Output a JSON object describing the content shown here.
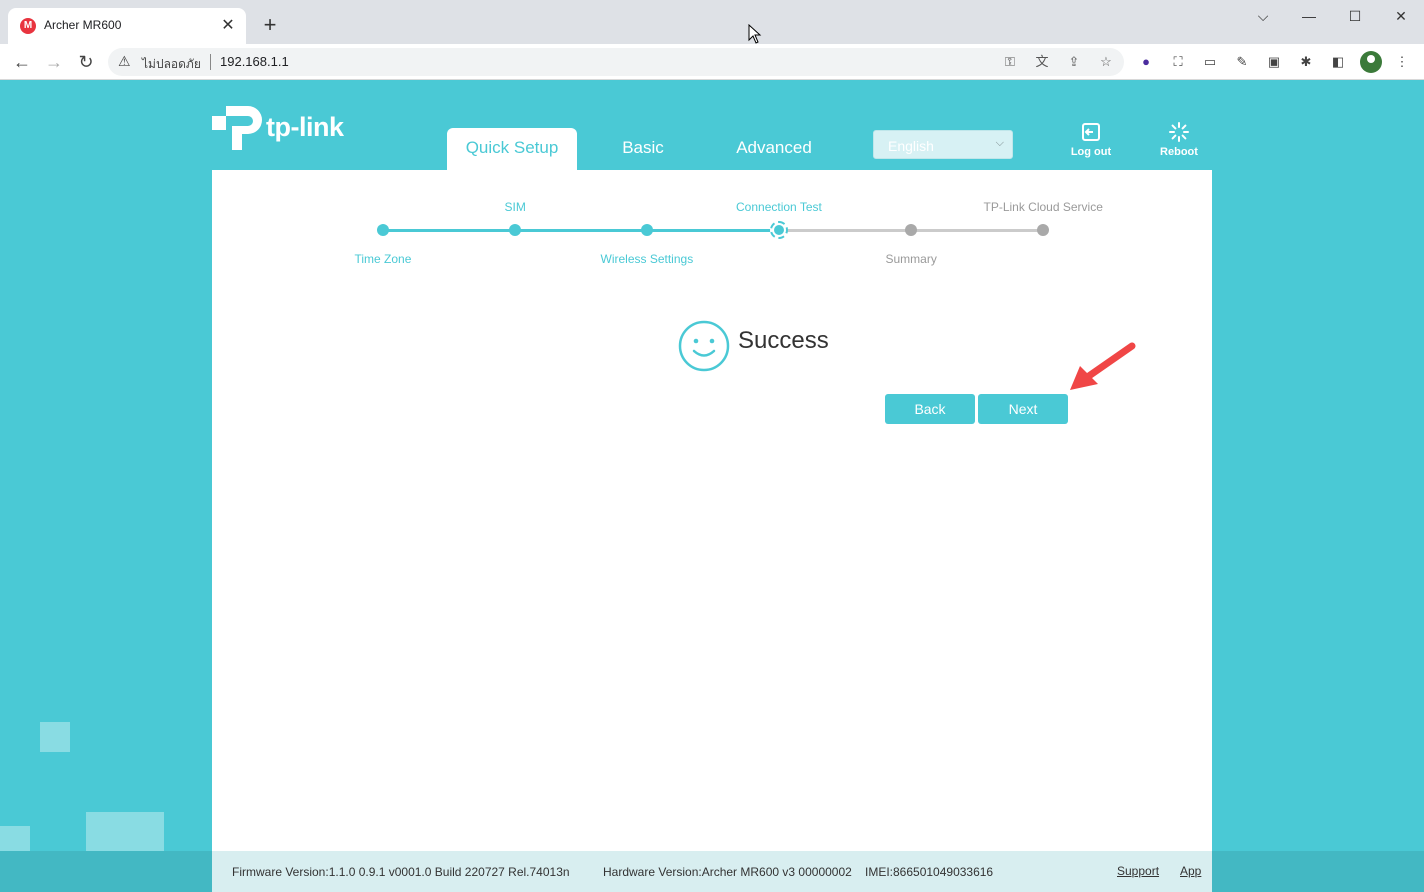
{
  "browser": {
    "tab_title": "Archer MR600",
    "tab_favicon": "M",
    "security_label": "ไม่ปลอดภัย",
    "url": "192.168.1.1"
  },
  "header": {
    "logo_text": "tp-link",
    "tabs": [
      {
        "label": "Quick Setup",
        "active": true
      },
      {
        "label": "Basic",
        "active": false
      },
      {
        "label": "Advanced",
        "active": false
      }
    ],
    "language": "English",
    "logout_label": "Log out",
    "reboot_label": "Reboot"
  },
  "stepper": {
    "steps": [
      {
        "label": "Time Zone",
        "state": "done"
      },
      {
        "label": "SIM",
        "state": "done"
      },
      {
        "label": "Wireless Settings",
        "state": "done"
      },
      {
        "label": "Connection Test",
        "state": "current"
      },
      {
        "label": "Summary",
        "state": "todo"
      },
      {
        "label": "TP-Link Cloud Service",
        "state": "todo"
      }
    ]
  },
  "result": {
    "status_text": "Success"
  },
  "actions": {
    "back_label": "Back",
    "next_label": "Next"
  },
  "footer": {
    "firmware": "Firmware Version:1.1.0 0.9.1 v0001.0 Build 220727 Rel.74013n",
    "hardware": "Hardware Version:Archer MR600 v3 00000002",
    "imei": "IMEI:866501049033616",
    "support_label": "Support",
    "app_label": "App"
  },
  "colors": {
    "brand": "#4ac9d5",
    "pending": "#a9a9a9",
    "annotation_arrow": "#f04646"
  }
}
